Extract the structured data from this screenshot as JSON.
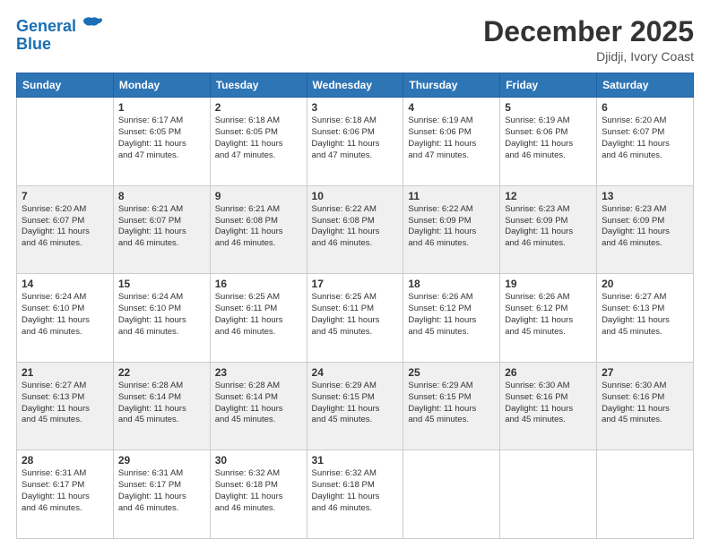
{
  "logo": {
    "line1": "General",
    "line2": "Blue"
  },
  "header": {
    "title": "December 2025",
    "location": "Djidji, Ivory Coast"
  },
  "weekdays": [
    "Sunday",
    "Monday",
    "Tuesday",
    "Wednesday",
    "Thursday",
    "Friday",
    "Saturday"
  ],
  "weeks": [
    [
      {
        "day": "",
        "sunrise": "",
        "sunset": "",
        "daylight": ""
      },
      {
        "day": "1",
        "sunrise": "Sunrise: 6:17 AM",
        "sunset": "Sunset: 6:05 PM",
        "daylight": "Daylight: 11 hours and 47 minutes."
      },
      {
        "day": "2",
        "sunrise": "Sunrise: 6:18 AM",
        "sunset": "Sunset: 6:05 PM",
        "daylight": "Daylight: 11 hours and 47 minutes."
      },
      {
        "day": "3",
        "sunrise": "Sunrise: 6:18 AM",
        "sunset": "Sunset: 6:06 PM",
        "daylight": "Daylight: 11 hours and 47 minutes."
      },
      {
        "day": "4",
        "sunrise": "Sunrise: 6:19 AM",
        "sunset": "Sunset: 6:06 PM",
        "daylight": "Daylight: 11 hours and 47 minutes."
      },
      {
        "day": "5",
        "sunrise": "Sunrise: 6:19 AM",
        "sunset": "Sunset: 6:06 PM",
        "daylight": "Daylight: 11 hours and 46 minutes."
      },
      {
        "day": "6",
        "sunrise": "Sunrise: 6:20 AM",
        "sunset": "Sunset: 6:07 PM",
        "daylight": "Daylight: 11 hours and 46 minutes."
      }
    ],
    [
      {
        "day": "7",
        "sunrise": "Sunrise: 6:20 AM",
        "sunset": "Sunset: 6:07 PM",
        "daylight": "Daylight: 11 hours and 46 minutes."
      },
      {
        "day": "8",
        "sunrise": "Sunrise: 6:21 AM",
        "sunset": "Sunset: 6:07 PM",
        "daylight": "Daylight: 11 hours and 46 minutes."
      },
      {
        "day": "9",
        "sunrise": "Sunrise: 6:21 AM",
        "sunset": "Sunset: 6:08 PM",
        "daylight": "Daylight: 11 hours and 46 minutes."
      },
      {
        "day": "10",
        "sunrise": "Sunrise: 6:22 AM",
        "sunset": "Sunset: 6:08 PM",
        "daylight": "Daylight: 11 hours and 46 minutes."
      },
      {
        "day": "11",
        "sunrise": "Sunrise: 6:22 AM",
        "sunset": "Sunset: 6:09 PM",
        "daylight": "Daylight: 11 hours and 46 minutes."
      },
      {
        "day": "12",
        "sunrise": "Sunrise: 6:23 AM",
        "sunset": "Sunset: 6:09 PM",
        "daylight": "Daylight: 11 hours and 46 minutes."
      },
      {
        "day": "13",
        "sunrise": "Sunrise: 6:23 AM",
        "sunset": "Sunset: 6:09 PM",
        "daylight": "Daylight: 11 hours and 46 minutes."
      }
    ],
    [
      {
        "day": "14",
        "sunrise": "Sunrise: 6:24 AM",
        "sunset": "Sunset: 6:10 PM",
        "daylight": "Daylight: 11 hours and 46 minutes."
      },
      {
        "day": "15",
        "sunrise": "Sunrise: 6:24 AM",
        "sunset": "Sunset: 6:10 PM",
        "daylight": "Daylight: 11 hours and 46 minutes."
      },
      {
        "day": "16",
        "sunrise": "Sunrise: 6:25 AM",
        "sunset": "Sunset: 6:11 PM",
        "daylight": "Daylight: 11 hours and 46 minutes."
      },
      {
        "day": "17",
        "sunrise": "Sunrise: 6:25 AM",
        "sunset": "Sunset: 6:11 PM",
        "daylight": "Daylight: 11 hours and 45 minutes."
      },
      {
        "day": "18",
        "sunrise": "Sunrise: 6:26 AM",
        "sunset": "Sunset: 6:12 PM",
        "daylight": "Daylight: 11 hours and 45 minutes."
      },
      {
        "day": "19",
        "sunrise": "Sunrise: 6:26 AM",
        "sunset": "Sunset: 6:12 PM",
        "daylight": "Daylight: 11 hours and 45 minutes."
      },
      {
        "day": "20",
        "sunrise": "Sunrise: 6:27 AM",
        "sunset": "Sunset: 6:13 PM",
        "daylight": "Daylight: 11 hours and 45 minutes."
      }
    ],
    [
      {
        "day": "21",
        "sunrise": "Sunrise: 6:27 AM",
        "sunset": "Sunset: 6:13 PM",
        "daylight": "Daylight: 11 hours and 45 minutes."
      },
      {
        "day": "22",
        "sunrise": "Sunrise: 6:28 AM",
        "sunset": "Sunset: 6:14 PM",
        "daylight": "Daylight: 11 hours and 45 minutes."
      },
      {
        "day": "23",
        "sunrise": "Sunrise: 6:28 AM",
        "sunset": "Sunset: 6:14 PM",
        "daylight": "Daylight: 11 hours and 45 minutes."
      },
      {
        "day": "24",
        "sunrise": "Sunrise: 6:29 AM",
        "sunset": "Sunset: 6:15 PM",
        "daylight": "Daylight: 11 hours and 45 minutes."
      },
      {
        "day": "25",
        "sunrise": "Sunrise: 6:29 AM",
        "sunset": "Sunset: 6:15 PM",
        "daylight": "Daylight: 11 hours and 45 minutes."
      },
      {
        "day": "26",
        "sunrise": "Sunrise: 6:30 AM",
        "sunset": "Sunset: 6:16 PM",
        "daylight": "Daylight: 11 hours and 45 minutes."
      },
      {
        "day": "27",
        "sunrise": "Sunrise: 6:30 AM",
        "sunset": "Sunset: 6:16 PM",
        "daylight": "Daylight: 11 hours and 45 minutes."
      }
    ],
    [
      {
        "day": "28",
        "sunrise": "Sunrise: 6:31 AM",
        "sunset": "Sunset: 6:17 PM",
        "daylight": "Daylight: 11 hours and 46 minutes."
      },
      {
        "day": "29",
        "sunrise": "Sunrise: 6:31 AM",
        "sunset": "Sunset: 6:17 PM",
        "daylight": "Daylight: 11 hours and 46 minutes."
      },
      {
        "day": "30",
        "sunrise": "Sunrise: 6:32 AM",
        "sunset": "Sunset: 6:18 PM",
        "daylight": "Daylight: 11 hours and 46 minutes."
      },
      {
        "day": "31",
        "sunrise": "Sunrise: 6:32 AM",
        "sunset": "Sunset: 6:18 PM",
        "daylight": "Daylight: 11 hours and 46 minutes."
      },
      {
        "day": "",
        "sunrise": "",
        "sunset": "",
        "daylight": ""
      },
      {
        "day": "",
        "sunrise": "",
        "sunset": "",
        "daylight": ""
      },
      {
        "day": "",
        "sunrise": "",
        "sunset": "",
        "daylight": ""
      }
    ]
  ]
}
